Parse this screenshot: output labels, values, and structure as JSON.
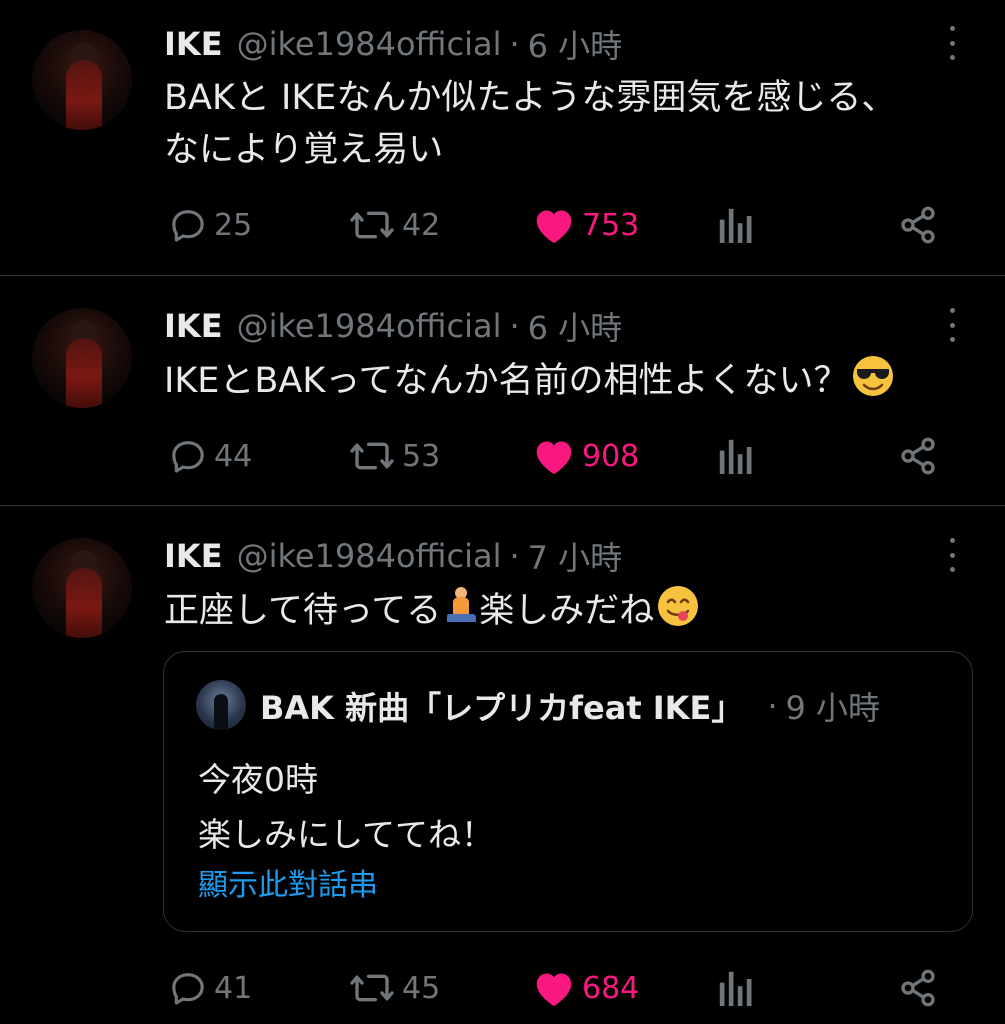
{
  "tweets": [
    {
      "name": "IKE",
      "handle": "@ike1984official",
      "sep": "·",
      "time": "6 小時",
      "text_lines": [
        "BAKと IKEなんか似たような雰囲気を感じる、",
        "なにより覚え易い"
      ],
      "replies": "25",
      "retweets": "42",
      "likes": "753"
    },
    {
      "name": "IKE",
      "handle": "@ike1984official",
      "sep": "·",
      "time": "6 小時",
      "text": "IKEとBAKってなんか名前の相性よくない？",
      "emoji": "smiling-face-with-sunglasses-emoji",
      "replies": "44",
      "retweets": "53",
      "likes": "908"
    },
    {
      "name": "IKE",
      "handle": "@ike1984official",
      "sep": "·",
      "time": "7 小時",
      "text_a": "正座して待ってる",
      "text_b": "楽しみだね",
      "emoji_a": "person-kneeling-emoji",
      "emoji_b": "face-savoring-food-emoji",
      "quote": {
        "name": "BAK 新曲「レプリカfeat IKE」",
        "sep": "·",
        "time": "9 小時",
        "lines": [
          "今夜0時",
          "楽しみにしててね！"
        ],
        "show_thread": "顯示此對話串"
      },
      "replies": "41",
      "retweets": "45",
      "likes": "684"
    }
  ],
  "icons": {
    "reply": "speech-bubble-icon",
    "retweet": "retweet-icon",
    "like": "heart-icon",
    "views": "bar-chart-icon",
    "share": "share-icon",
    "more": "vertical-ellipsis-icon"
  },
  "colors": {
    "background": "#000000",
    "text": "#e7e9ea",
    "secondary": "#71767b",
    "like": "#f91880",
    "link": "#1d9bf0",
    "divider": "#2f3336"
  }
}
